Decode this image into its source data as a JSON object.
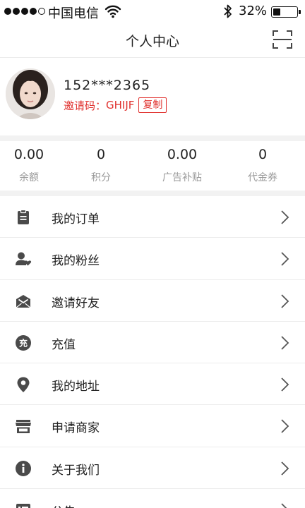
{
  "status_bar": {
    "carrier": "中国电信",
    "battery_percent": "32%",
    "battery_level": 0.32,
    "signal_bars": 4,
    "signal_total": 5
  },
  "nav": {
    "title": "个人中心",
    "scan_icon": "scan-icon"
  },
  "profile": {
    "phone": "152***2365",
    "invite_label": "邀请码：",
    "invite_code": "GHIJF",
    "copy_label": "复制"
  },
  "stats": [
    {
      "value": "0.00",
      "label": "余额"
    },
    {
      "value": "0",
      "label": "积分"
    },
    {
      "value": "0.00",
      "label": "广告补贴"
    },
    {
      "value": "0",
      "label": "代金券"
    }
  ],
  "menu": [
    {
      "label": "我的订单",
      "icon": "clipboard-icon"
    },
    {
      "label": "我的粉丝",
      "icon": "fans-icon"
    },
    {
      "label": "邀请好友",
      "icon": "invite-mail-icon"
    },
    {
      "label": "充值",
      "icon": "recharge-icon",
      "icon_text": "充"
    },
    {
      "label": "我的地址",
      "icon": "location-pin-icon"
    },
    {
      "label": "申请商家",
      "icon": "store-icon"
    },
    {
      "label": "关于我们",
      "icon": "info-icon"
    },
    {
      "label": "公告",
      "icon": "announcement-icon"
    }
  ],
  "colors": {
    "accent": "#e0312e",
    "icon": "#4a4a4a",
    "divider": "#ececec",
    "section_bg": "#f2f2f2"
  }
}
